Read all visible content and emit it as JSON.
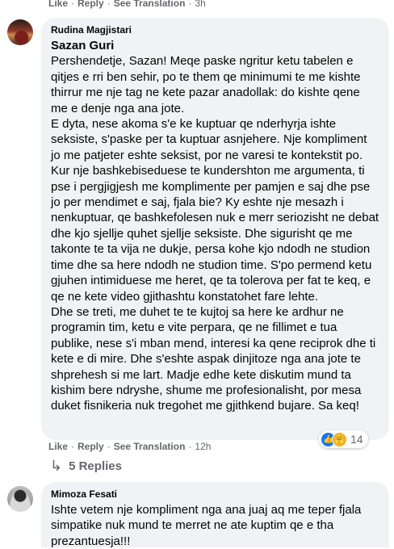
{
  "top_meta": {
    "like": "Like",
    "reply": "Reply",
    "see_translation": "See Translation",
    "time": "3h"
  },
  "comment1": {
    "author": "Rudina Magjistari",
    "mention": "Sazan Guri",
    "paragraphs": [
      "Pershendetje, Sazan! Meqe paske ngritur ketu tabelen e qitjes e rri ben sehir, po te them qe minimumi te me kishte thirrur me nje tag ne kete pazar anadollak: do kishte qene me e denje nga ana jote.",
      "E dyta, nese akoma s'e ke kuptuar qe nderhyrja ishte seksiste, s'paske per ta kuptuar asnjehere. Nje kompliment jo me patjeter eshte seksist, por ne varesi te kontekstit po. Kur nje bashkebiseduese te kundershton me argumenta, ti pse i pergjigjesh me komplimente per pamjen e saj dhe pse jo per mendimet e saj, fjala bie? Ky eshte nje mesazh i nenkuptuar, qe bashkefolesen nuk e merr seriozisht ne debat dhe kjo sjellje quhet sjellje seksiste. Dhe sigurisht qe me takonte te ta vija ne dukje, persa kohe kjo ndodh ne studion time dhe sa here ndodh ne studion time. S'po permend ketu gjuhen intimiduese me heret, qe ta tolerova per fat te keq, e qe ne kete video gjithashtu konstatohet fare lehte.",
      "Dhe se treti, me duhet te te kujtoj sa here ke ardhur ne programin tim, ketu e vite perpara, qe ne fillimet e tua publike, nese s'i mban mend, interesi ka qene reciprok dhe ti kete e di mire. Dhe s'eshte aspak dinjitoze nga ana jote te shprehesh si me lart. Madje edhe kete diskutim mund ta kishim bere ndryshe, shume me profesionalisht, por mesa duket fisnikeria nuk tregohet me gjithkend bujare. Sa keq!"
    ],
    "meta": {
      "like": "Like",
      "reply": "Reply",
      "see_translation": "See Translation",
      "time": "12h"
    },
    "reaction_count": "14",
    "replies_label": "5 Replies"
  },
  "comment2": {
    "author": "Mimoza Fesati",
    "text": "Ishte vetem nje kompliment nga ana juaj aq me teper fjala simpatike nuk mund te merret ne ate kuptim qe e tha prezantuesja!!!"
  },
  "colors": {
    "bubble": "#f0f2f5",
    "meta_text": "#65676b",
    "like_blue": "#1877f2"
  },
  "icons": {
    "like": "like-reaction-icon",
    "care": "care-reaction-icon",
    "replies": "reply-arrow-icon"
  }
}
